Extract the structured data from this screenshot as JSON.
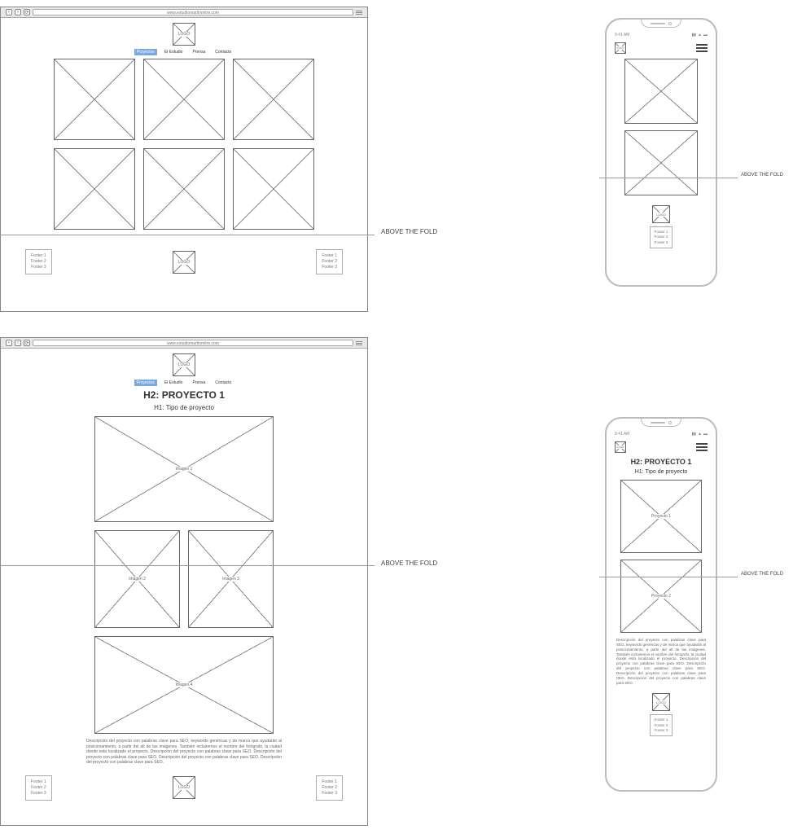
{
  "url": "www.estudiomartinmitre.com",
  "logo": "LOGO",
  "nav": {
    "proyectos": "Proyectos",
    "estudio": "El Estudio",
    "prensa": "Prensa",
    "contacto": "Contacto"
  },
  "footer": {
    "l1": "Footer 1",
    "l2": "Footer 2",
    "l3": "Footer 3"
  },
  "fold": "ABOVE THE FOLD",
  "phone_time": "9:41 AM",
  "detail": {
    "h2": "H2: PROYECTO 1",
    "h1": "H1: Tipo de proyecto",
    "img1": "Imagen 1",
    "img2": "Imagen 2",
    "img3": "Imagen 3",
    "img4": "Imagen 4",
    "desc": "Descripción del proyecto con palabras clave para SEO, keywords genéricas y de marca que ayudarán al posicionamiento, a partir del alt de las imágenes. También incluiremos el nombre del fotógrafo, la ciudad donde está localizado el proyecto. Descripción del proyecto con palabras clave para SEO. Descripción del proyecto con palabras clave para SEO. Descripción del proyecto con palabras clave para SEO. Descripción del proyecto con palabras clave para SEO."
  },
  "phone_detail": {
    "p1": "Proyecto 1",
    "p2": "Proyecto 2",
    "desc": "Descripción del proyecto con palabras clave para SEO, keywords genéricas y de marca que ayudarán al posicionamiento, a partir del alt de las imágenes. También incluiremos el nombre del fotógrafo, la ciudad donde está localizado el proyecto. Descripción del proyecto con palabras clave para SEO. Descripción del proyecto con palabras clave para SEO. Descripción del proyecto con palabras clave para SEO. Descripción del proyecto con palabras clave para SEO."
  }
}
